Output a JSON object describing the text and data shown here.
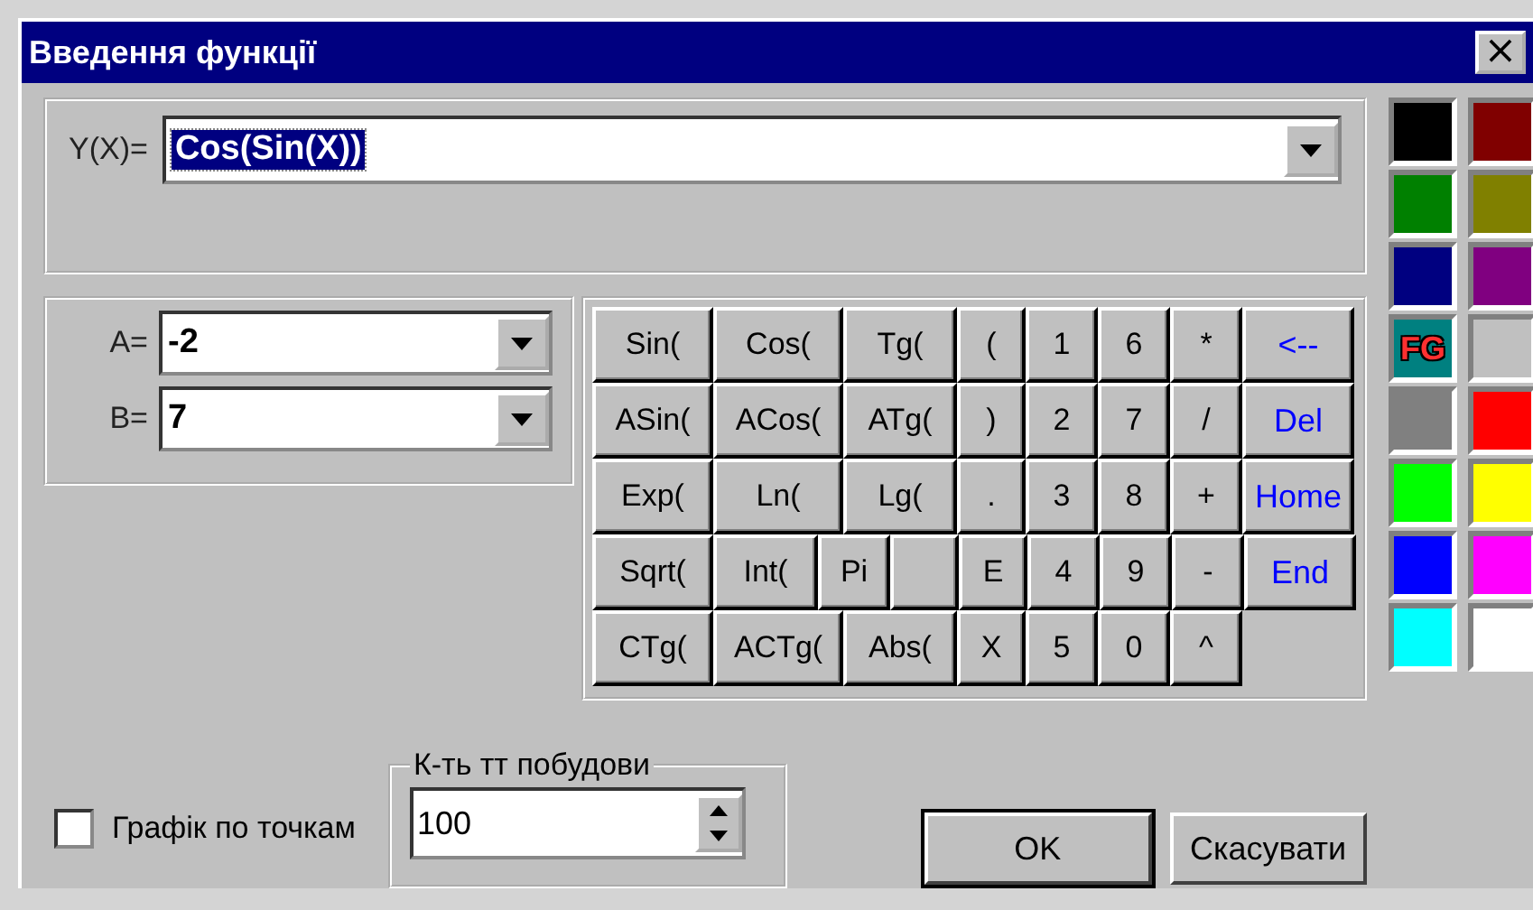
{
  "window": {
    "title": "Введення функції",
    "close": "×"
  },
  "function": {
    "label": "Y(X)=",
    "value": "Cos(Sin(X))",
    "selected": true
  },
  "range": [
    {
      "label": "A=",
      "value": "-2"
    },
    {
      "label": "B=",
      "value": "7"
    }
  ],
  "keypad": [
    [
      {
        "label": "Sin(",
        "kind": "fn"
      },
      {
        "label": "Cos(",
        "kind": "fn"
      },
      {
        "label": "Tg(",
        "kind": "fn"
      },
      {
        "label": "(",
        "kind": "fn"
      },
      {
        "label": "1",
        "kind": "fn"
      },
      {
        "label": "6",
        "kind": "fn"
      },
      {
        "label": "*",
        "kind": "fn"
      },
      {
        "label": "<--",
        "kind": "edit"
      }
    ],
    [
      {
        "label": "ASin(",
        "kind": "fn"
      },
      {
        "label": "ACos(",
        "kind": "fn"
      },
      {
        "label": "ATg(",
        "kind": "fn"
      },
      {
        "label": ")",
        "kind": "fn"
      },
      {
        "label": "2",
        "kind": "fn"
      },
      {
        "label": "7",
        "kind": "fn"
      },
      {
        "label": "/",
        "kind": "fn"
      },
      {
        "label": "Del",
        "kind": "edit"
      }
    ],
    [
      {
        "label": "Exp(",
        "kind": "fn"
      },
      {
        "label": "Ln(",
        "kind": "fn"
      },
      {
        "label": "Lg(",
        "kind": "fn"
      },
      {
        "label": ".",
        "kind": "fn"
      },
      {
        "label": "3",
        "kind": "fn"
      },
      {
        "label": "8",
        "kind": "fn"
      },
      {
        "label": "+",
        "kind": "fn"
      },
      {
        "label": "Home",
        "kind": "edit"
      }
    ],
    [
      {
        "label": "Sqrt(",
        "kind": "fn"
      },
      {
        "label": "Int(",
        "kind": "fn"
      },
      {
        "label": "Pi",
        "kind": "fn"
      },
      {
        "kind": "blank"
      },
      {
        "label": "E",
        "kind": "fn"
      },
      {
        "label": "4",
        "kind": "fn"
      },
      {
        "label": "9",
        "kind": "fn"
      },
      {
        "label": "-",
        "kind": "fn"
      },
      {
        "label": "End",
        "kind": "edit"
      }
    ],
    [
      {
        "label": "CTg(",
        "kind": "fn"
      },
      {
        "label": "ACTg(",
        "kind": "fn"
      },
      {
        "label": "Abs(",
        "kind": "fn"
      },
      {
        "label": "X",
        "kind": "fn"
      },
      {
        "label": "5",
        "kind": "fn"
      },
      {
        "label": "0",
        "kind": "fn"
      },
      {
        "label": "^",
        "kind": "fn"
      }
    ]
  ],
  "palette": [
    {
      "color": "#000000"
    },
    {
      "color": "#800000"
    },
    {
      "color": "#008000"
    },
    {
      "color": "#808000"
    },
    {
      "color": "#000080"
    },
    {
      "color": "#800080"
    },
    {
      "color": "#008080",
      "label": "FG"
    },
    {
      "color": "#c0c0c0"
    },
    {
      "color": "#808080"
    },
    {
      "color": "#ff0000"
    },
    {
      "color": "#00ff00"
    },
    {
      "color": "#ffff00"
    },
    {
      "color": "#0000ff"
    },
    {
      "color": "#ff00ff"
    },
    {
      "color": "#00ffff"
    },
    {
      "color": "#ffffff"
    }
  ],
  "points_checkbox": {
    "label": "Графік по точкам",
    "checked": false
  },
  "point_count": {
    "title": "К-ть тт побудови",
    "value": "100"
  },
  "buttons": [
    {
      "label": "OK",
      "default": true
    },
    {
      "label": "Скасувати",
      "default": false
    }
  ]
}
